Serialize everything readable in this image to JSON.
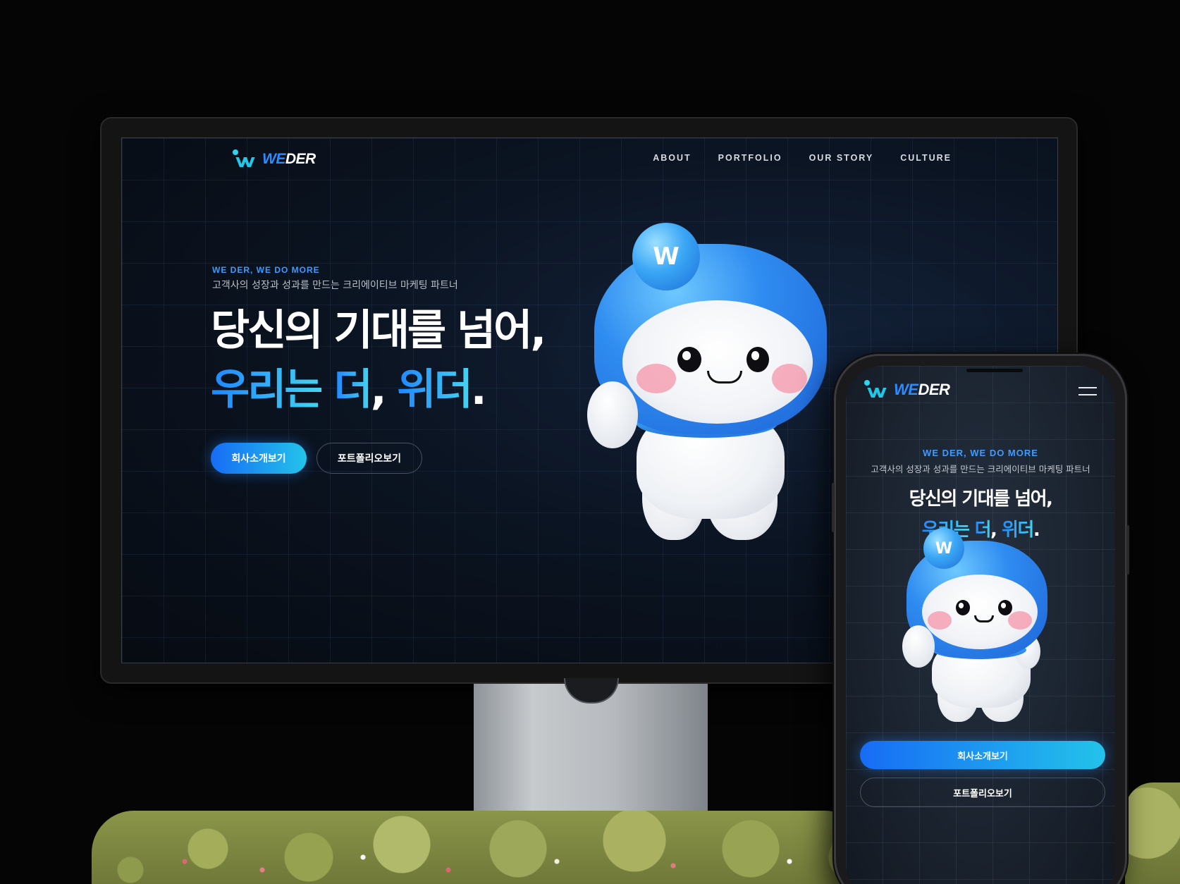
{
  "brand": {
    "logo_prefix": "WE",
    "logo_suffix": "DER"
  },
  "desktop": {
    "nav": [
      "ABOUT",
      "PORTFOLIO",
      "OUR STORY",
      "CULTURE"
    ],
    "hero": {
      "eyebrow": "WE DER, WE DO MORE",
      "subtitle": "고객사의 성장과 성과를 만드는 크리에이티브 마케팅 파트너",
      "headline_line1": "당신의 기대를 넘어,",
      "headline_line2_parts": [
        "우리는",
        " ",
        "더",
        ", ",
        "위더",
        "."
      ]
    },
    "buttons": {
      "primary": "회사소개보기",
      "secondary": "포트폴리오보기"
    }
  },
  "mobile": {
    "hero": {
      "eyebrow": "WE DER, WE DO MORE",
      "subtitle": "고객사의 성장과 성과를 만드는 크리에이티브 마케팅 파트너",
      "headline_line1": "당신의 기대를 넘어,",
      "headline_line2_parts": [
        "우리는",
        " ",
        "더",
        ", ",
        "위더",
        "."
      ]
    },
    "buttons": {
      "primary": "회사소개보기",
      "secondary": "포트폴리오보기"
    }
  },
  "colors": {
    "accent_blue": "#2b8cff",
    "accent_cyan": "#23c3ea",
    "background": "#070b12"
  },
  "icons": {
    "menu": "hamburger-menu-icon",
    "logo": "weder-logo-icon",
    "mascot": "weder-mascot-character"
  }
}
